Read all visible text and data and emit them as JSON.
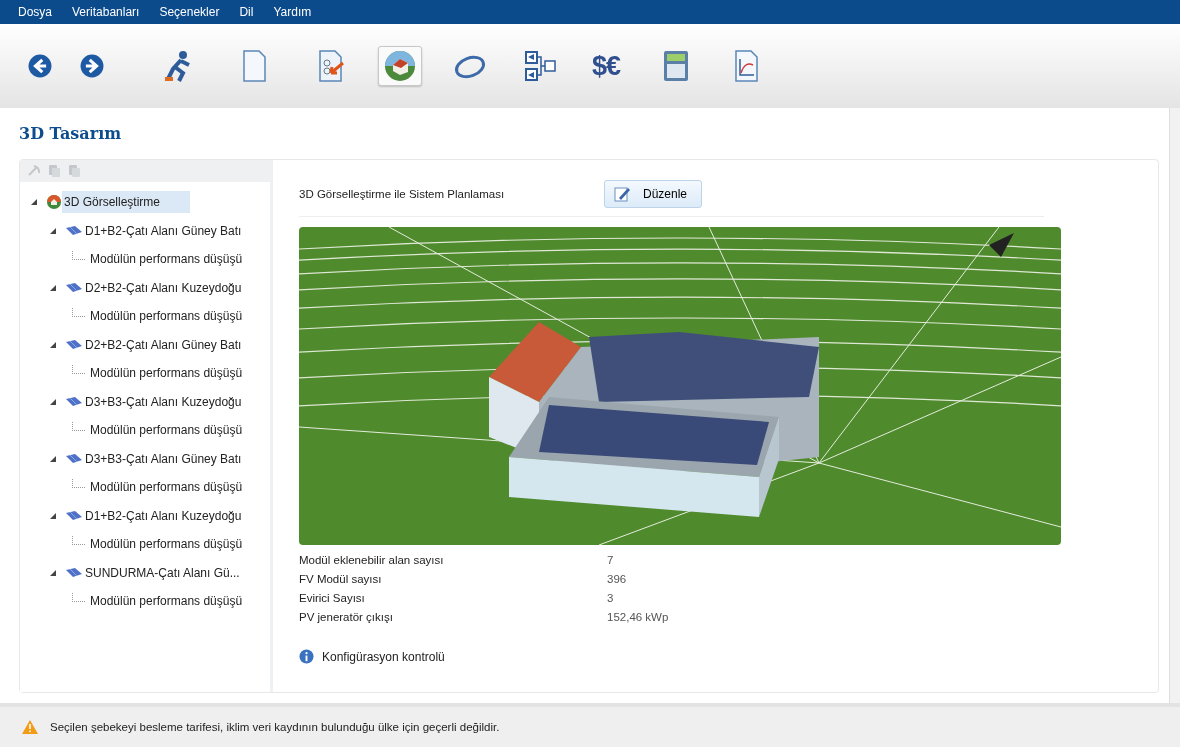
{
  "menu": [
    "Dosya",
    "Veritabanları",
    "Seçenekler",
    "Dil",
    "Yardım"
  ],
  "toolbar": [
    {
      "kind": "back",
      "selected": false
    },
    {
      "kind": "forward",
      "selected": false
    },
    {
      "kind": "runner",
      "selected": false
    },
    {
      "kind": "document",
      "selected": false
    },
    {
      "kind": "import",
      "selected": false
    },
    {
      "kind": "globe",
      "selected": true
    },
    {
      "kind": "ring",
      "selected": false
    },
    {
      "kind": "diagram",
      "selected": false
    },
    {
      "kind": "currency",
      "selected": false,
      "glyph": "$€"
    },
    {
      "kind": "calculator",
      "selected": false
    },
    {
      "kind": "chart",
      "selected": false
    }
  ],
  "page_title": "3D Tasarım",
  "tree_toolbar": [
    {
      "kind": "refresh",
      "disabled": true
    },
    {
      "kind": "copy",
      "disabled": true
    },
    {
      "kind": "paste",
      "disabled": true
    }
  ],
  "tree": [
    {
      "label": "3D Görselleştirme",
      "selected": true,
      "expanded": true,
      "children": [
        {
          "label": "D1+B2-Çatı Alanı Güney Batı",
          "selected": false,
          "expanded": true,
          "children": [
            {
              "label": "Modülün performans düşüşü",
              "selected": false
            }
          ]
        },
        {
          "label": "D2+B2-Çatı Alanı Kuzeydoğu",
          "selected": false,
          "expanded": true,
          "children": [
            {
              "label": "Modülün performans düşüşü",
              "selected": false
            }
          ]
        },
        {
          "label": "D2+B2-Çatı Alanı Güney Batı",
          "selected": false,
          "expanded": true,
          "children": [
            {
              "label": "Modülün performans düşüşü",
              "selected": false
            }
          ]
        },
        {
          "label": "D3+B3-Çatı Alanı Kuzeydoğu",
          "selected": false,
          "expanded": true,
          "children": [
            {
              "label": "Modülün performans düşüşü",
              "selected": false
            }
          ]
        },
        {
          "label": "D3+B3-Çatı Alanı Güney Batı",
          "selected": false,
          "expanded": true,
          "children": [
            {
              "label": "Modülün performans düşüşü",
              "selected": false
            }
          ]
        },
        {
          "label": "D1+B2-Çatı Alanı Kuzeydoğu",
          "selected": false,
          "expanded": true,
          "children": [
            {
              "label": "Modülün performans düşüşü",
              "selected": false
            }
          ]
        },
        {
          "label": "SUNDURMA-Çatı Alanı Gü...",
          "selected": false,
          "expanded": true,
          "children": [
            {
              "label": "Modülün performans düşüşü",
              "selected": false
            }
          ]
        }
      ]
    }
  ],
  "section_label": "3D Görselleştirme ile Sistem Planlaması",
  "edit_button": "Düzenle",
  "stats": [
    {
      "label": "Modül eklenebilir alan sayısı",
      "value": "7"
    },
    {
      "label": "FV Modül sayısı",
      "value": "396"
    },
    {
      "label": "Evirici Sayısı",
      "value": "3"
    },
    {
      "label": "PV jeneratör çıkışı",
      "value": "152,46 kWp"
    }
  ],
  "config_check": "Konfigürasyon kontrolü",
  "status_message": "Seçilen şebekeyi besleme tarifesi, iklim veri kaydının bulunduğu ülke için geçerli değildir."
}
